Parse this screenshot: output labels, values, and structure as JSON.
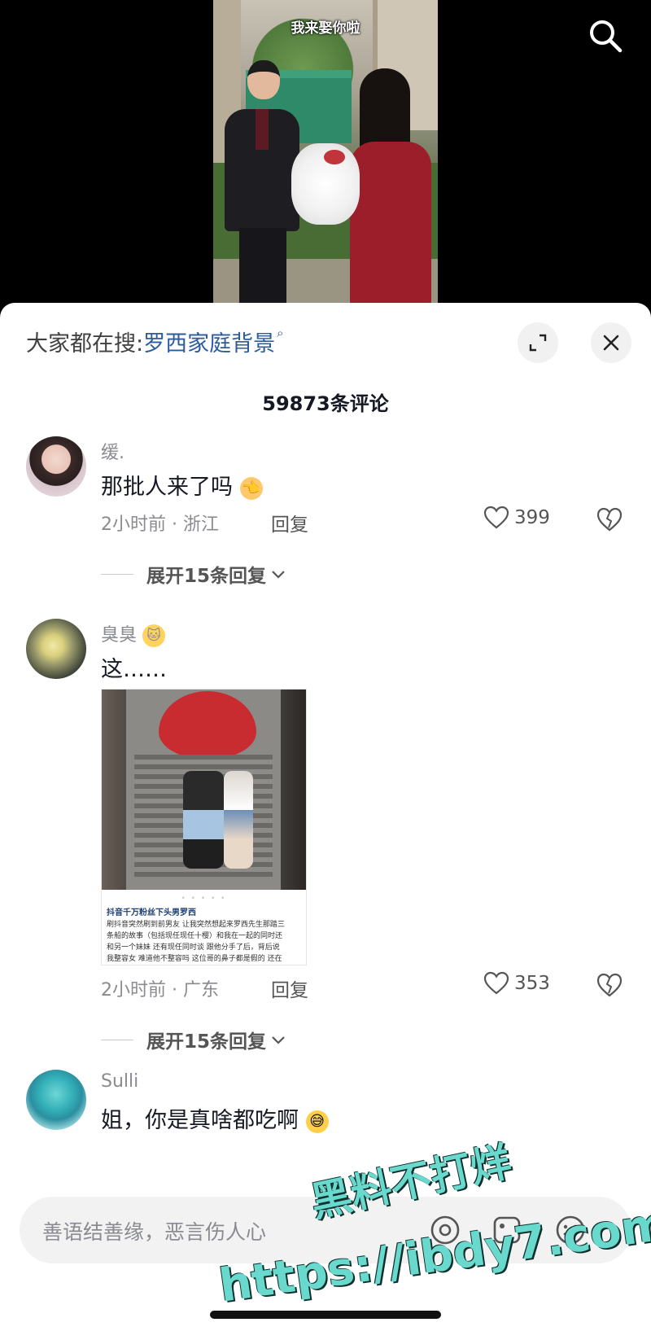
{
  "video": {
    "caption": "我来娶你啦"
  },
  "search": {
    "icon": "search-icon"
  },
  "panel": {
    "suggest_prefix": "大家都在搜:",
    "suggest_keyword": "罗西家庭背景",
    "comment_count": "59873条评论"
  },
  "comments": [
    {
      "name": "缓.",
      "text": "那批人来了吗",
      "text_emoji": "👈",
      "time_location": "2小时前 · 浙江",
      "reply_label": "回复",
      "likes": "399",
      "expand_label": "展开15条回复"
    },
    {
      "name": "臭臭",
      "name_emoji": "🐱",
      "text": "这……",
      "image": {
        "title": "抖音千万粉丝下头男罗西",
        "body": "刷抖音突然刷到前男友 让我突然想起来罗西先生那踏三\n条船的故事（包括现任现任十樱）和我在一起的同时还\n和另一个妹妹 还有现任同时谈 跟他分手了后，背后说\n我整容女 难道他不整容吗 这位哥的鼻子都是假的 还在"
      },
      "time_location": "2小时前 · 广东",
      "reply_label": "回复",
      "likes": "353",
      "expand_label": "展开15条回复"
    },
    {
      "name": "Sulli",
      "text": "姐，你是真啥都吃啊",
      "text_emoji": "😅"
    }
  ],
  "input": {
    "placeholder": "善语结善缘，恶言伤人心"
  },
  "watermark": {
    "line1": "黑料不打烊",
    "line2": "https://ibdy7.com"
  }
}
